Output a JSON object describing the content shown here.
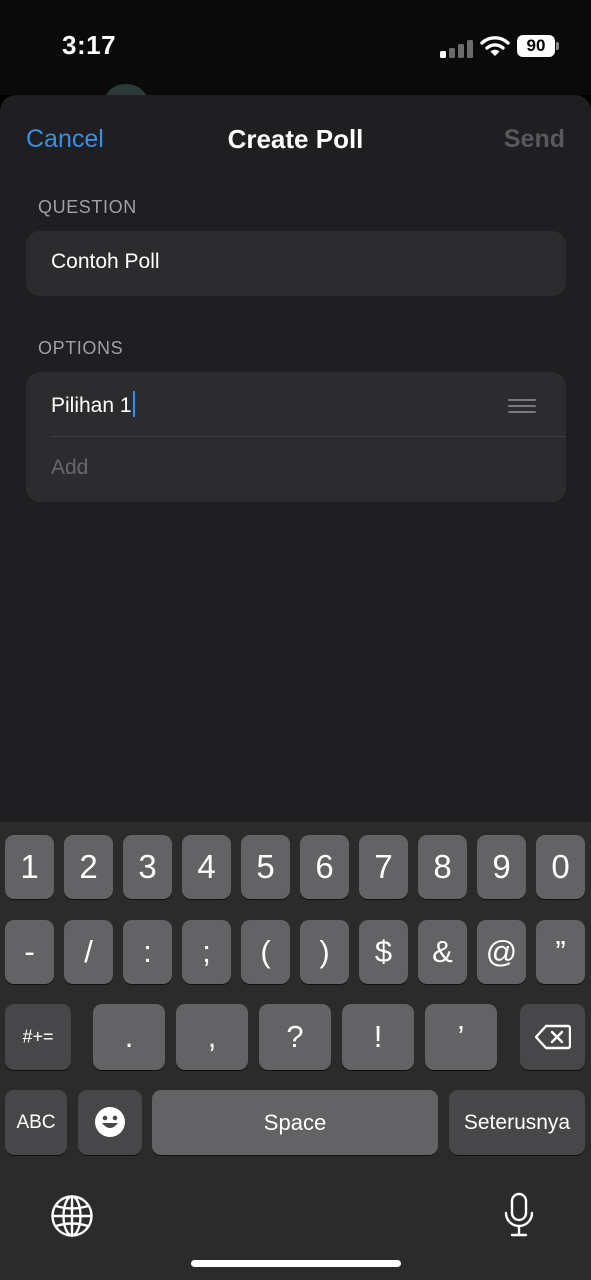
{
  "status_bar": {
    "time": "3:17",
    "battery": "90",
    "signal_icon": "cellular-signal-icon",
    "wifi_icon": "wifi-icon",
    "battery_icon": "battery-icon"
  },
  "nav": {
    "cancel_label": "Cancel",
    "title": "Create Poll",
    "send_label": "Send"
  },
  "question": {
    "section_label": "QUESTION",
    "value": "Contoh Poll"
  },
  "options": {
    "section_label": "OPTIONS",
    "items": [
      {
        "value": "Pilihan 1"
      }
    ],
    "add_placeholder": "Add"
  },
  "keyboard": {
    "row1": [
      "1",
      "2",
      "3",
      "4",
      "5",
      "6",
      "7",
      "8",
      "9",
      "0"
    ],
    "row2": [
      "-",
      "/",
      ":",
      ";",
      "(",
      ")",
      "$",
      "&",
      "@",
      "”"
    ],
    "row3_switch": "#+=",
    "row3": [
      ".",
      ",",
      "?",
      "!",
      "’"
    ],
    "abc_label": "ABC",
    "space_label": "Space",
    "return_label": "Seterusnya",
    "emoji_icon": "emoji-icon",
    "backspace_icon": "backspace-icon",
    "globe_icon": "globe-icon",
    "mic_icon": "microphone-icon"
  },
  "colors": {
    "accent": "#3a8ee6",
    "sheet_bg": "#1f1f21",
    "card_bg": "#2c2c2e",
    "key_bg": "#636366",
    "key_dark_bg": "#474749"
  }
}
